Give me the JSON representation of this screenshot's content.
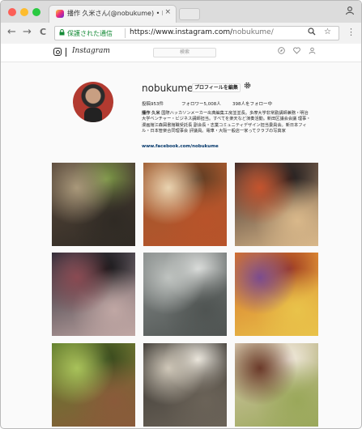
{
  "browser": {
    "tab_title": "播作 久米さん(@nobukume) • Instagram",
    "tab_close": "×",
    "nav_back": "←",
    "nav_forward": "→",
    "nav_reload": "C",
    "secure_label": "保護された通信",
    "url_main": "https://www.instagram.com/",
    "url_path": "nobukume/",
    "menu_dots": "⋮"
  },
  "instagram": {
    "wordmark": "Instagram",
    "search_placeholder": "検索"
  },
  "profile": {
    "username": "nobukume",
    "edit_button": "プロフィールを編集",
    "posts": "投稿953件",
    "followers": "フォロワー5,008人",
    "following": "398人をフォロー中",
    "bio_name": "播作 久米",
    "bio_text": "国際ハッカソンメーカー出典編集工房並並長。多摩大学非常勤講師兼務・明治大学ベンチャー・ビジネス講師担当。すべてを楽天など演奏活動。新田区議会会議 理事・漫画館江森図書館職受託長 副会長・志業コミュニティデザイン担当委員会。新日本フィル・日本管楽合同理事会 評議員。電車・大阪一般店一家ってクラブの写真家",
    "link": "www.facebook.com/nobukume"
  },
  "photos": [
    {
      "alt": "station-platform-photo",
      "colors": [
        "#5b4a3c",
        "#a9987a",
        "#2f2a24",
        "#7c9a46"
      ]
    },
    {
      "alt": "plated-dishes-photo",
      "colors": [
        "#9c5a2f",
        "#e9d3b0",
        "#b8532a",
        "#5a3a22"
      ]
    },
    {
      "alt": "ornate-mask-photo",
      "colors": [
        "#3a2a28",
        "#c4532d",
        "#d9b88a",
        "#1d1a1c"
      ]
    },
    {
      "alt": "street-parade-photo",
      "colors": [
        "#2b2a36",
        "#8a4a52",
        "#c0a7a4",
        "#151416"
      ]
    },
    {
      "alt": "frosted-glass-photo",
      "colors": [
        "#8a8f8e",
        "#bfc3c0",
        "#4f5452",
        "#dfe1df"
      ]
    },
    {
      "alt": "orange-fabric-art-photo",
      "colors": [
        "#d6712a",
        "#7b4b8e",
        "#e9c34a",
        "#9c3a22"
      ]
    },
    {
      "alt": "rusty-pipe-on-moss-photo",
      "colors": [
        "#5f7d2c",
        "#a8c25a",
        "#8a5a3a",
        "#33451b"
      ]
    },
    {
      "alt": "vintage-floral-print-photo",
      "colors": [
        "#3a3733",
        "#cfc7b8",
        "#6b6358",
        "#f0ece3"
      ]
    },
    {
      "alt": "food-platter-photo",
      "colors": [
        "#d9c9b0",
        "#6b3a2a",
        "#9aa85a",
        "#f3ece0"
      ]
    }
  ]
}
